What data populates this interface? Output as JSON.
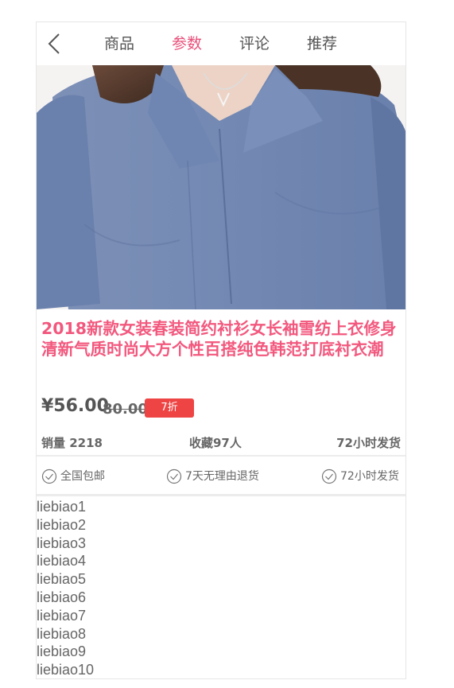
{
  "header": {
    "back_icon": "chevron-left-icon",
    "tabs": [
      {
        "label": "商品",
        "active": false
      },
      {
        "label": "参数",
        "active": true
      },
      {
        "label": "评论",
        "active": false
      },
      {
        "label": "推荐",
        "active": false
      }
    ]
  },
  "product": {
    "title": "2018新款女装春装简约衬衫女长袖雪纺上衣修身清新气质时尚大方个性百搭纯色韩范打底衬衣潮",
    "price": "¥56.00",
    "original_price": "80.00",
    "discount": "7折"
  },
  "stats": {
    "sales": "销量 2218",
    "favorites": "收藏97人",
    "shipping": "72小时发货"
  },
  "services": [
    {
      "label": "全国包邮"
    },
    {
      "label": "7天无理由退货"
    },
    {
      "label": "72小时发货"
    }
  ],
  "list": [
    "liebiao1",
    "liebiao2",
    "liebiao3",
    "liebiao4",
    "liebiao5",
    "liebiao6",
    "liebiao7",
    "liebiao8",
    "liebiao9",
    "liebiao10"
  ],
  "colors": {
    "accent": "#e8507a",
    "title": "#f2587e",
    "discount_bg": "#ee4444",
    "shirt": "#6f86b2"
  }
}
